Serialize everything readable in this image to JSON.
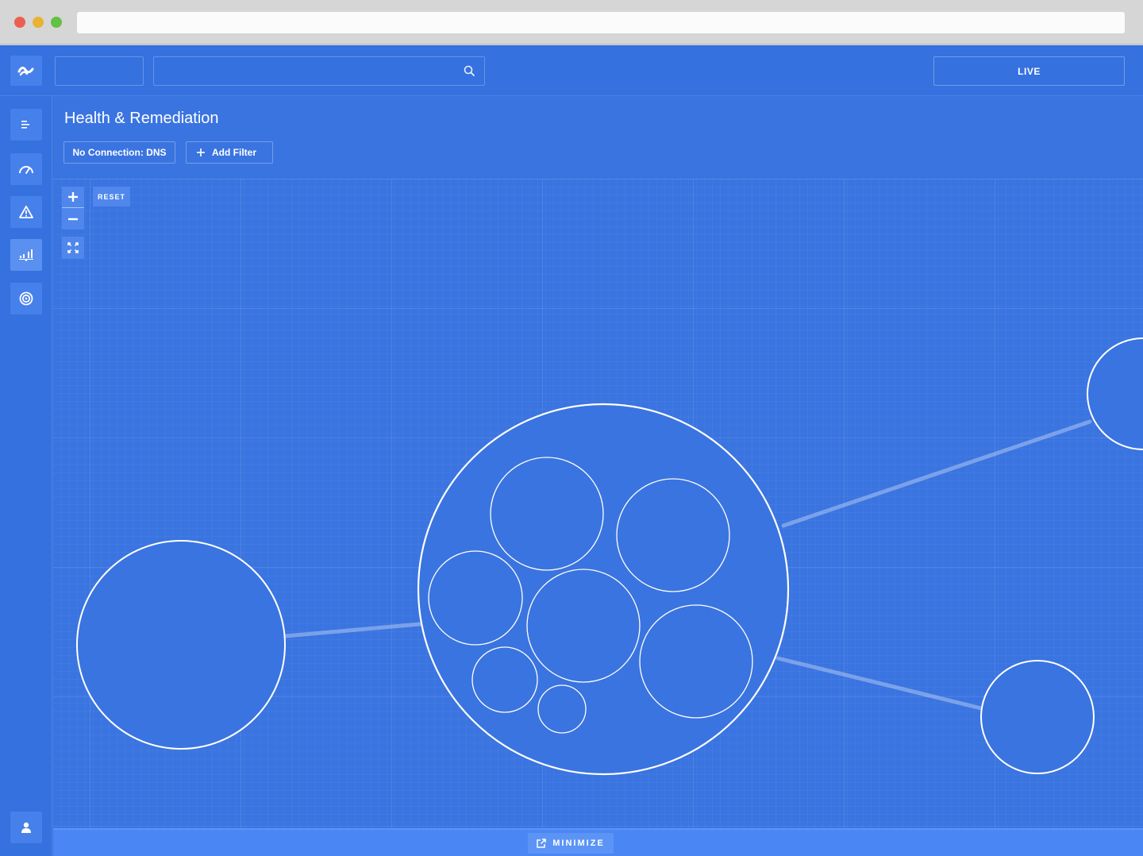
{
  "page": {
    "title": "Health & Remediation"
  },
  "topbar": {
    "live_label": "LIVE"
  },
  "filters": {
    "active_filter": "No Connection: DNS",
    "add_filter_label": "Add Filter"
  },
  "canvas_controls": {
    "zoom_in_symbol": "+",
    "zoom_out_symbol": "−",
    "reset_label": "RESET"
  },
  "bottom_bar": {
    "minimize_label": "MINIMIZE"
  },
  "sidebar": {
    "items": [
      {
        "icon": "list-icon"
      },
      {
        "icon": "dashboard-gauge-icon"
      },
      {
        "icon": "warning-icon"
      },
      {
        "icon": "network-chart-icon",
        "active": true
      },
      {
        "icon": "target-icon"
      }
    ],
    "footer_icon": "user-icon"
  },
  "colors": {
    "app_background": "#3a74e0",
    "topbar": "#3571df",
    "bottom_bar": "#4a87f5",
    "node_stroke": "#ffffff"
  }
}
